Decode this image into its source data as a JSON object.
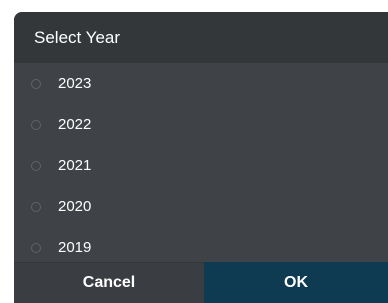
{
  "dialog": {
    "title": "Select Year",
    "options": [
      {
        "label": "2023",
        "selected": false
      },
      {
        "label": "2022",
        "selected": false
      },
      {
        "label": "2021",
        "selected": false
      },
      {
        "label": "2020",
        "selected": false
      },
      {
        "label": "2019",
        "selected": false
      }
    ],
    "cancel_label": "Cancel",
    "ok_label": "OK"
  },
  "colors": {
    "dialog_bg": "#3f4347",
    "header_bg": "#33373a",
    "ok_bg": "#0e3a52",
    "text": "#ffffff"
  }
}
